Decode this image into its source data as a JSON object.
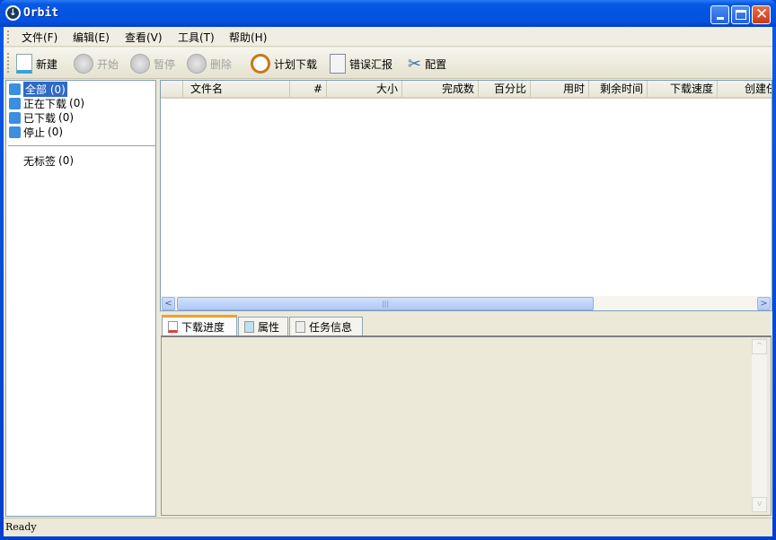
{
  "window": {
    "title": "Orbit",
    "icon": "download-arrow-icon"
  },
  "menu": [
    "文件(F)",
    "编辑(E)",
    "查看(V)",
    "工具(T)",
    "帮助(H)"
  ],
  "toolbar": [
    {
      "label": "新建",
      "icon": "new-file-icon",
      "enabled": true
    },
    {
      "label": "开始",
      "icon": "play-icon",
      "enabled": false
    },
    {
      "label": "暂停",
      "icon": "pause-icon",
      "enabled": false
    },
    {
      "label": "删除",
      "icon": "delete-icon",
      "enabled": false
    },
    {
      "label": "计划下载",
      "icon": "clock-icon",
      "enabled": true
    },
    {
      "label": "错误汇报",
      "icon": "report-icon",
      "enabled": true
    },
    {
      "label": "配置",
      "icon": "tools-icon",
      "enabled": true
    }
  ],
  "sidebar": {
    "items": [
      {
        "label": "全部",
        "count": "(0)",
        "selected": true
      },
      {
        "label": "正在下载",
        "count": "(0)"
      },
      {
        "label": "已下载",
        "count": "(0)"
      },
      {
        "label": "停止",
        "count": "(0)"
      }
    ],
    "tags": [
      {
        "label": "无标签",
        "count": "(0)"
      }
    ]
  },
  "table": {
    "columns": [
      "",
      "文件名",
      "#",
      "大小",
      "完成数",
      "百分比",
      "用时",
      "剩余时间",
      "下载速度",
      "创建任"
    ],
    "rows": []
  },
  "tabs": [
    "下载进度",
    "属性",
    "任务信息"
  ],
  "status": "Ready",
  "colors": {
    "titlebar": "#0450e0",
    "selection": "#316ac5",
    "face": "#ece9d8"
  }
}
